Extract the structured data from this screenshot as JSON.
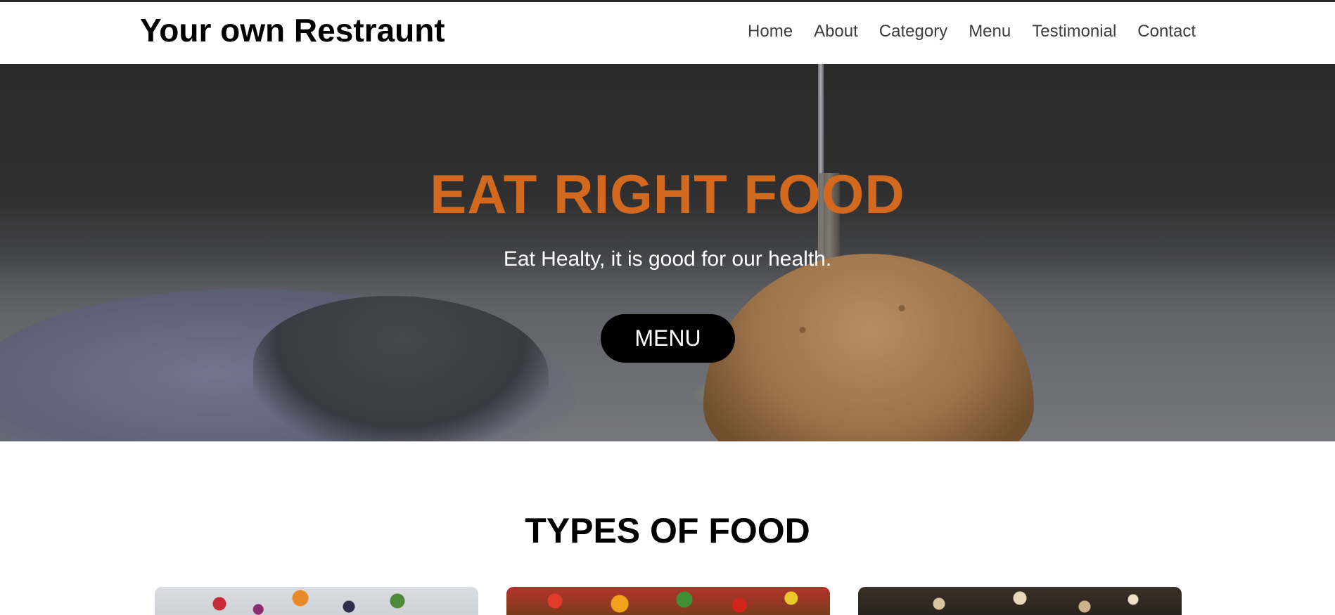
{
  "header": {
    "brand": "Your own Restraunt",
    "nav": [
      {
        "label": "Home"
      },
      {
        "label": "About"
      },
      {
        "label": "Category"
      },
      {
        "label": "Menu"
      },
      {
        "label": "Testimonial"
      },
      {
        "label": "Contact"
      }
    ]
  },
  "hero": {
    "title": "EAT RIGHT FOOD",
    "subtitle": "Eat Healty, it is good for our health.",
    "button_label": "MENU",
    "title_color": "#d2691e"
  },
  "types_section": {
    "title": "TYPES OF FOOD",
    "cards": [
      {
        "image": "fruit-bowl-image"
      },
      {
        "image": "vegetables-image"
      },
      {
        "image": "grains-image"
      }
    ]
  }
}
